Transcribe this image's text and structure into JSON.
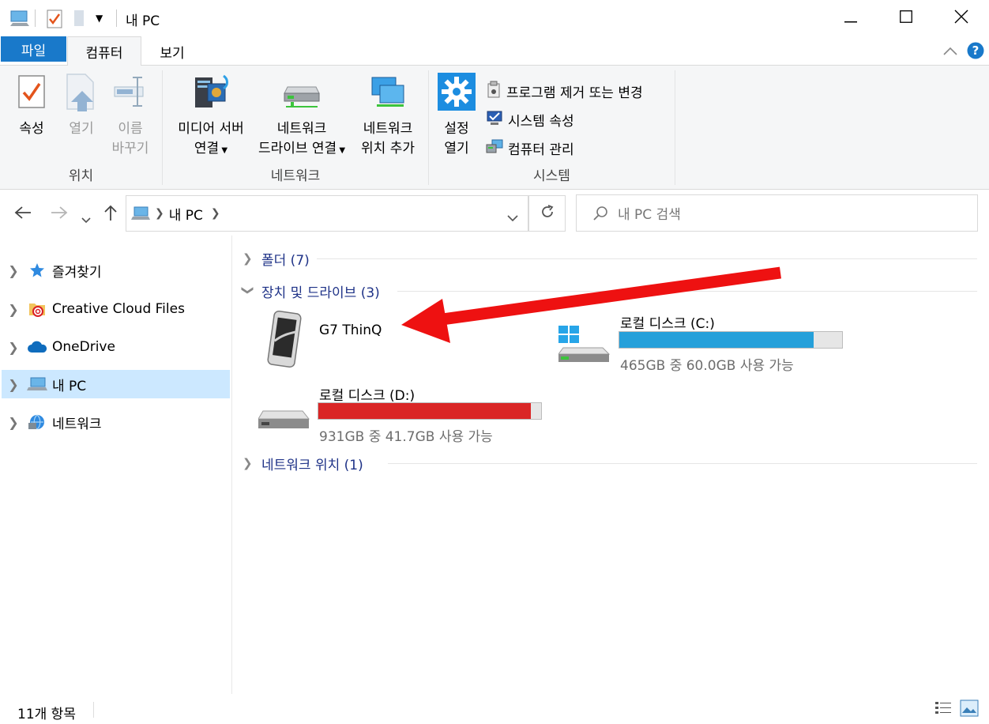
{
  "window": {
    "title": "내 PC",
    "minimize_icon": "minimize-icon",
    "maximize_icon": "maximize-icon",
    "close_icon": "close-icon"
  },
  "tabs": {
    "file": "파일",
    "computer": "컴퓨터",
    "view": "보기",
    "active": "컴퓨터"
  },
  "ribbon": {
    "location": {
      "label": "위치",
      "properties": "속성",
      "open": "열기",
      "rename_line1": "이름",
      "rename_line2": "바꾸기"
    },
    "network": {
      "label": "네트워크",
      "media_line1": "미디어 서버",
      "media_line2": "연결",
      "map_line1": "네트워크",
      "map_line2": "드라이브 연결",
      "add_line1": "네트워크",
      "add_line2": "위치 추가"
    },
    "system": {
      "label": "시스템",
      "settings_line1": "설정",
      "settings_line2": "열기",
      "uninstall": "프로그램 제거 또는 변경",
      "properties": "시스템 속성",
      "manage": "컴퓨터 관리"
    }
  },
  "address": {
    "path": "내 PC",
    "search_placeholder": "내 PC 검색"
  },
  "nav": {
    "items": [
      {
        "label": "즐겨찾기",
        "icon": "star-icon"
      },
      {
        "label": "Creative Cloud Files",
        "icon": "creative-cloud-folder-icon"
      },
      {
        "label": "OneDrive",
        "icon": "cloud-icon"
      },
      {
        "label": "내 PC",
        "icon": "computer-icon",
        "selected": true
      },
      {
        "label": "네트워크",
        "icon": "network-icon"
      }
    ]
  },
  "content": {
    "groups": {
      "folders": "폴더 (7)",
      "devices": "장치 및 드라이브 (3)",
      "network": "네트워크 위치 (1)"
    },
    "devices": [
      {
        "name": "G7 ThinQ",
        "icon": "phone-icon"
      },
      {
        "name": "로컬 디스크 (C:)",
        "detail": "465GB 중 60.0GB 사용 가능",
        "used_fraction": 0.871,
        "bar_color": "#26a0da",
        "icon": "windows-drive-icon"
      },
      {
        "name": "로컬 디스크 (D:)",
        "detail": "931GB 중 41.7GB 사용 가능",
        "used_fraction": 0.955,
        "bar_color": "#da2626",
        "icon": "drive-icon"
      }
    ]
  },
  "status": {
    "count": "11개 항목"
  },
  "colors": {
    "accent": "#1979ca",
    "selection": "#cce8ff",
    "annotation_arrow": "#ee1111"
  }
}
